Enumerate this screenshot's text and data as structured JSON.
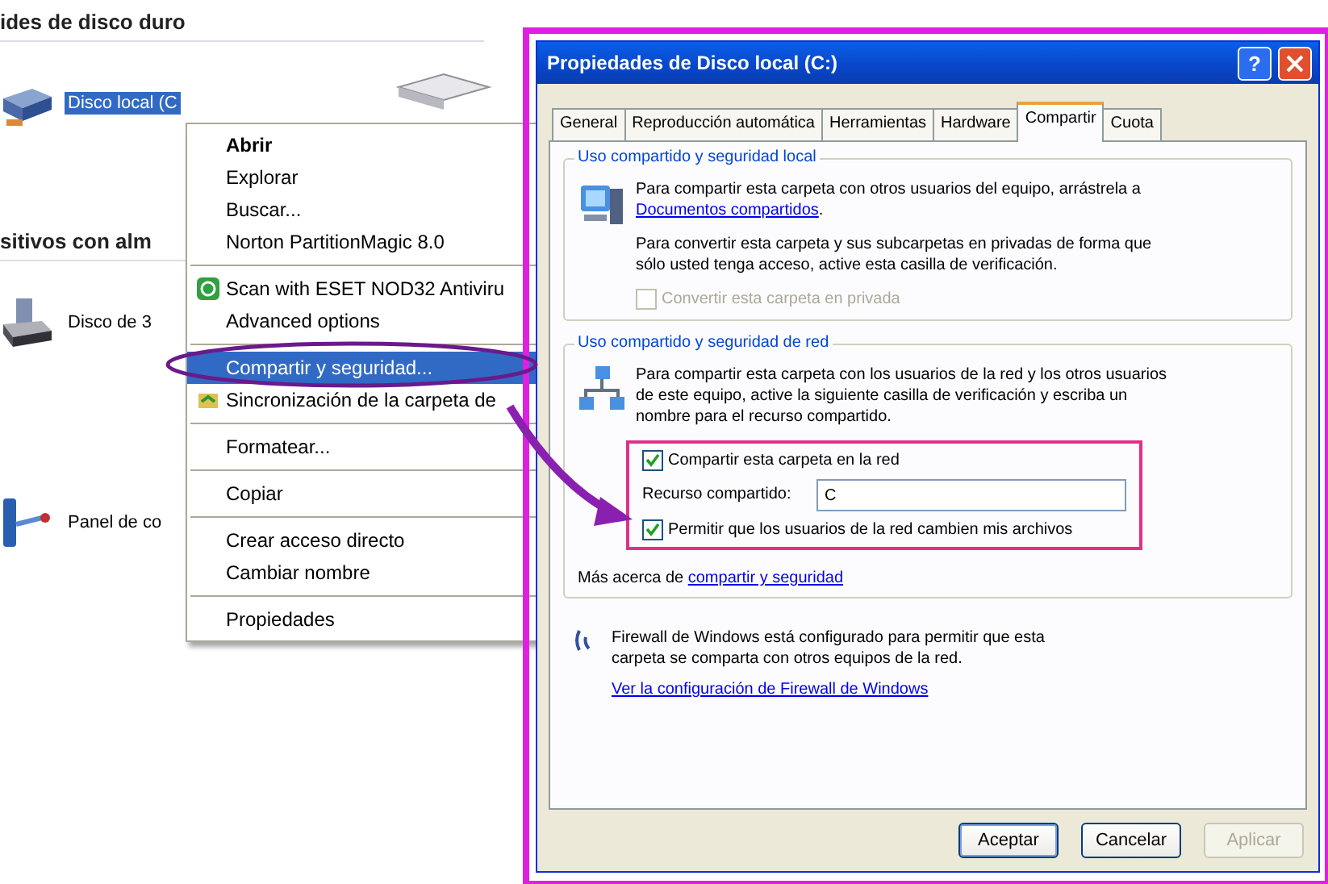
{
  "explorer": {
    "sections": [
      {
        "heading": "ides de disco duro",
        "items": [
          {
            "label": "Disco local (C",
            "kind": "hard-drive",
            "selected": true
          }
        ]
      },
      {
        "heading": "sitivos con alm",
        "items": [
          {
            "label": "Disco de 3",
            "kind": "floppy",
            "selected": false
          }
        ]
      },
      {
        "items": [
          {
            "label": "Panel de co",
            "kind": "control-panel",
            "selected": false
          }
        ]
      }
    ]
  },
  "context_menu": {
    "groups": [
      [
        {
          "label": "Abrir",
          "bold": true,
          "selected": false,
          "kind": "text"
        },
        {
          "label": "Explorar",
          "bold": false,
          "selected": false,
          "kind": "text"
        },
        {
          "label": "Buscar...",
          "bold": false,
          "selected": false,
          "kind": "text"
        },
        {
          "label": "Norton PartitionMagic 8.0",
          "bold": false,
          "selected": false,
          "kind": "text"
        }
      ],
      [
        {
          "label": "Scan with ESET NOD32 Antiviru",
          "bold": false,
          "selected": false,
          "kind": "scan"
        },
        {
          "label": "Advanced options",
          "bold": false,
          "selected": false,
          "kind": "text"
        }
      ],
      [
        {
          "label": "Compartir y seguridad...",
          "bold": false,
          "selected": true,
          "kind": "text"
        },
        {
          "label": "Sincronización de la carpeta de",
          "bold": false,
          "selected": false,
          "kind": "sync"
        }
      ],
      [
        {
          "label": "Formatear...",
          "bold": false,
          "selected": false,
          "kind": "text"
        }
      ],
      [
        {
          "label": "Copiar",
          "bold": false,
          "selected": false,
          "kind": "text"
        }
      ],
      [
        {
          "label": "Crear acceso directo",
          "bold": false,
          "selected": false,
          "kind": "text"
        },
        {
          "label": "Cambiar nombre",
          "bold": false,
          "selected": false,
          "kind": "text"
        }
      ],
      [
        {
          "label": "Propiedades",
          "bold": false,
          "selected": false,
          "kind": "text"
        }
      ]
    ]
  },
  "dialog": {
    "title": "Propiedades de Disco local (C:)",
    "help": "?",
    "tabs": [
      {
        "label": "General",
        "selected": false
      },
      {
        "label": "Reproducción automática",
        "selected": false
      },
      {
        "label": "Herramientas",
        "selected": false
      },
      {
        "label": "Hardware",
        "selected": false
      },
      {
        "label": "Compartir",
        "selected": true
      },
      {
        "label": "Cuota",
        "selected": false
      }
    ],
    "local_group": {
      "title": "Uso compartido y seguridad local",
      "text": "Para compartir esta carpeta con otros usuarios del equipo, arrástrela a ",
      "link": "Documentos compartidos",
      "text_end": ".",
      "private_text": "Para convertir esta carpeta y sus subcarpetas en privadas de forma que sólo usted tenga acceso, active esta casilla de verificación.",
      "private_checkbox": {
        "label": "Convertir esta carpeta en privada",
        "checked": false,
        "disabled": true
      }
    },
    "network_group": {
      "title": "Uso compartido y seguridad de red",
      "text": "Para compartir esta carpeta con los usuarios de la red y los otros usuarios de este equipo, active la siguiente casilla de verificación y escriba un nombre para el recurso compartido.",
      "share_checkbox": {
        "label": "Compartir esta carpeta en la red",
        "checked": true,
        "disabled": false
      },
      "share_name": {
        "label": "Recurso compartido:",
        "value": "C"
      },
      "write_checkbox": {
        "label": "Permitir que los usuarios de la red cambien mis archivos",
        "checked": true,
        "disabled": false
      },
      "more_text": "Más acerca de ",
      "more_link": "compartir y seguridad"
    },
    "firewall": {
      "text": "Firewall de Windows está configurado para permitir que esta carpeta se comparta con otros equipos de la red.",
      "link": "Ver la configuración de Firewall de Windows"
    },
    "buttons": [
      {
        "label": "Aceptar",
        "disabled": false,
        "default": true
      },
      {
        "label": "Cancelar",
        "disabled": false,
        "default": false
      },
      {
        "label": "Aplicar",
        "disabled": true,
        "default": false
      }
    ]
  }
}
